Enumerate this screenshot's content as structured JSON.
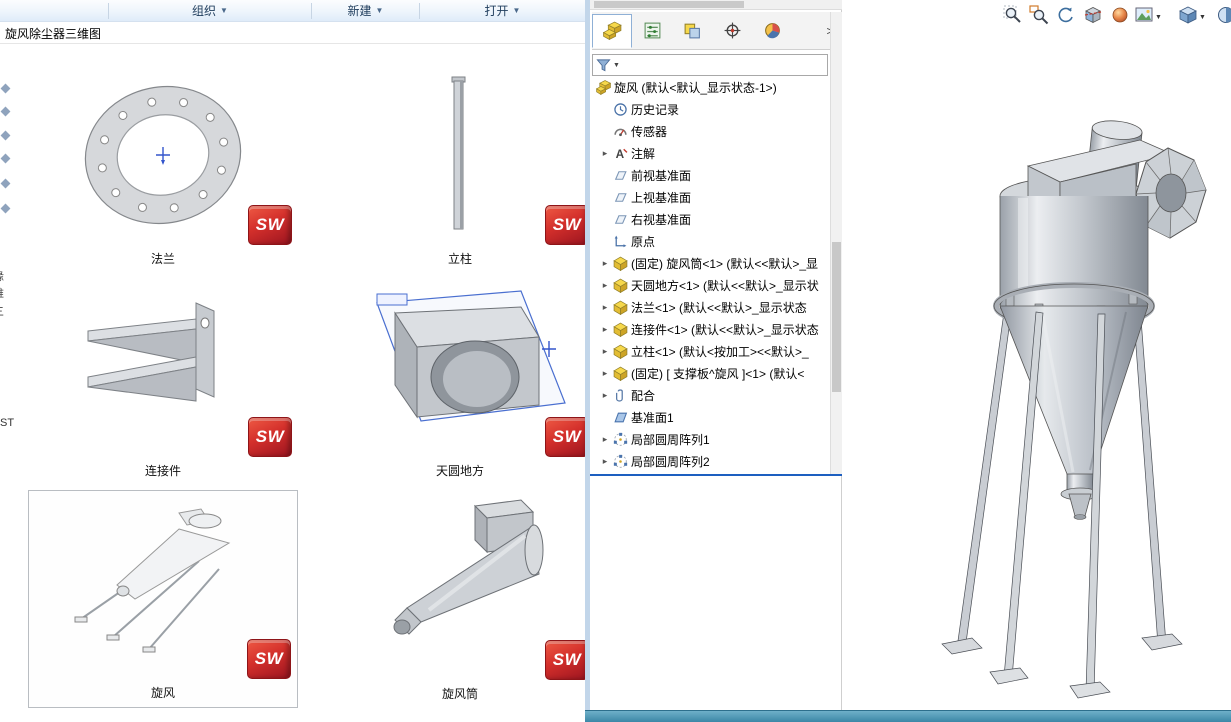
{
  "explorer": {
    "toolbar": {
      "organize": "组织",
      "new": "新建",
      "open": "打开"
    },
    "title": "旋风除尘器三维图",
    "side_strip": {
      "fragments": [
        "缘",
        "维",
        "三"
      ],
      "code": "ST"
    },
    "sw_badge": "SW",
    "thumbnails": [
      {
        "label": "法兰",
        "selected": false
      },
      {
        "label": "立柱",
        "selected": false
      },
      {
        "label": "连接件",
        "selected": false
      },
      {
        "label": "天圆地方",
        "selected": false
      },
      {
        "label": "旋风",
        "selected": true
      },
      {
        "label": "旋风筒",
        "selected": false
      }
    ]
  },
  "feature_panel": {
    "tabs": [
      {
        "name": "featuremanager-tab"
      },
      {
        "name": "propertymanager-tab"
      },
      {
        "name": "configurationmanager-tab"
      },
      {
        "name": "dimxpertmanager-tab"
      },
      {
        "name": "displaymanager-tab"
      }
    ],
    "overflow_chevron": ">",
    "filter_icon": "filter-funnel-icon",
    "tree": [
      {
        "label": "旋风 (默认<默认_显示状态-1>)",
        "icon": "assembly",
        "expandable": false
      },
      {
        "label": "历史记录",
        "icon": "history",
        "expandable": false
      },
      {
        "label": "传感器",
        "icon": "sensor",
        "expandable": false
      },
      {
        "label": "注解",
        "icon": "annotation",
        "expandable": true
      },
      {
        "label": "前视基准面",
        "icon": "plane",
        "expandable": false
      },
      {
        "label": "上视基准面",
        "icon": "plane",
        "expandable": false
      },
      {
        "label": "右视基准面",
        "icon": "plane",
        "expandable": false
      },
      {
        "label": "原点",
        "icon": "origin",
        "expandable": false
      },
      {
        "label": "(固定) 旋风筒<1> (默认<<默认>_显",
        "icon": "part",
        "expandable": true
      },
      {
        "label": "天圆地方<1> (默认<<默认>_显示状",
        "icon": "part",
        "expandable": true
      },
      {
        "label": "法兰<1> (默认<<默认>_显示状态",
        "icon": "part",
        "expandable": true
      },
      {
        "label": "连接件<1> (默认<<默认>_显示状态",
        "icon": "part",
        "expandable": true
      },
      {
        "label": "立柱<1> (默认<按加工><<默认>_",
        "icon": "part",
        "expandable": true
      },
      {
        "label": "(固定) [ 支撑板^旋风 ]<1> (默认<",
        "icon": "part",
        "expandable": true
      },
      {
        "label": "配合",
        "icon": "mates",
        "expandable": true
      },
      {
        "label": "基准面1",
        "icon": "plane-solid",
        "expandable": false
      },
      {
        "label": "局部圆周阵列1",
        "icon": "pattern",
        "expandable": true
      },
      {
        "label": "局部圆周阵列2",
        "icon": "pattern",
        "expandable": true
      }
    ]
  },
  "viewport": {
    "hud_icons": [
      "zoom-to-fit",
      "zoom-to-area",
      "previous-view",
      "section-view",
      "edit-appearance",
      "apply-scene",
      "view-orientation",
      "display-style"
    ]
  },
  "colors": {
    "accent_blue": "#1d5fc0",
    "sw_red": "#c1272d",
    "status_teal": "#3c87a6"
  }
}
